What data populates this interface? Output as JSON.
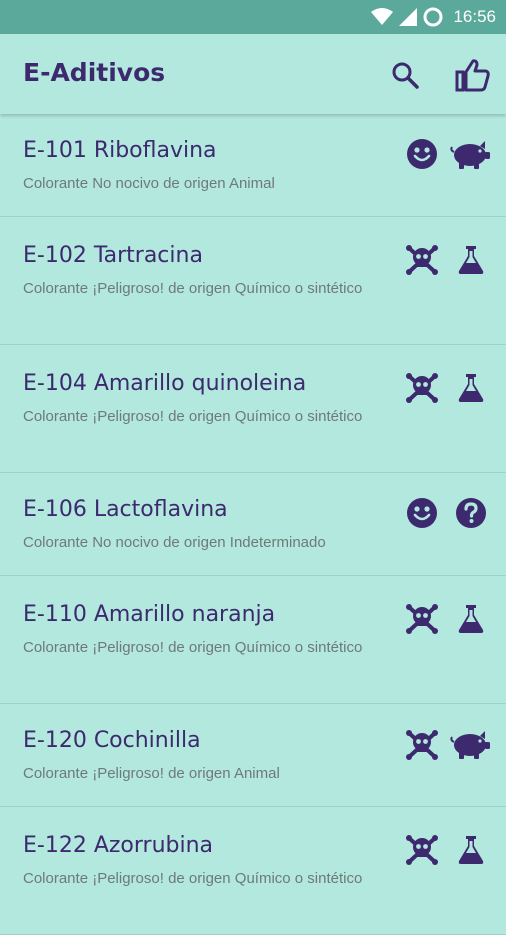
{
  "status": {
    "time": "16:56"
  },
  "app": {
    "title": "E-Aditivos"
  },
  "icons": {
    "search": "search-icon",
    "like": "thumbs-up-icon"
  },
  "items": [
    {
      "name": "E-101 Riboflavina",
      "desc": "Colorante No nocivo de origen Animal",
      "safety": "smile",
      "origin": "pig"
    },
    {
      "name": "E-102 Tartracina",
      "desc": "Colorante ¡Peligroso! de origen Químico o sintético",
      "safety": "skull",
      "origin": "flask"
    },
    {
      "name": "E-104 Amarillo quinoleina",
      "desc": "Colorante ¡Peligroso! de origen Químico o sintético",
      "safety": "skull",
      "origin": "flask"
    },
    {
      "name": "E-106 Lactoflavina",
      "desc": "Colorante No nocivo de origen Indeterminado",
      "safety": "smile",
      "origin": "question"
    },
    {
      "name": "E-110 Amarillo naranja",
      "desc": "Colorante ¡Peligroso! de origen Químico o sintético",
      "safety": "skull",
      "origin": "flask"
    },
    {
      "name": "E-120 Cochinilla",
      "desc": "Colorante ¡Peligroso! de origen Animal",
      "safety": "skull",
      "origin": "pig"
    },
    {
      "name": "E-122 Azorrubina",
      "desc": "Colorante ¡Peligroso! de origen Químico o sintético",
      "safety": "skull",
      "origin": "flask"
    }
  ]
}
